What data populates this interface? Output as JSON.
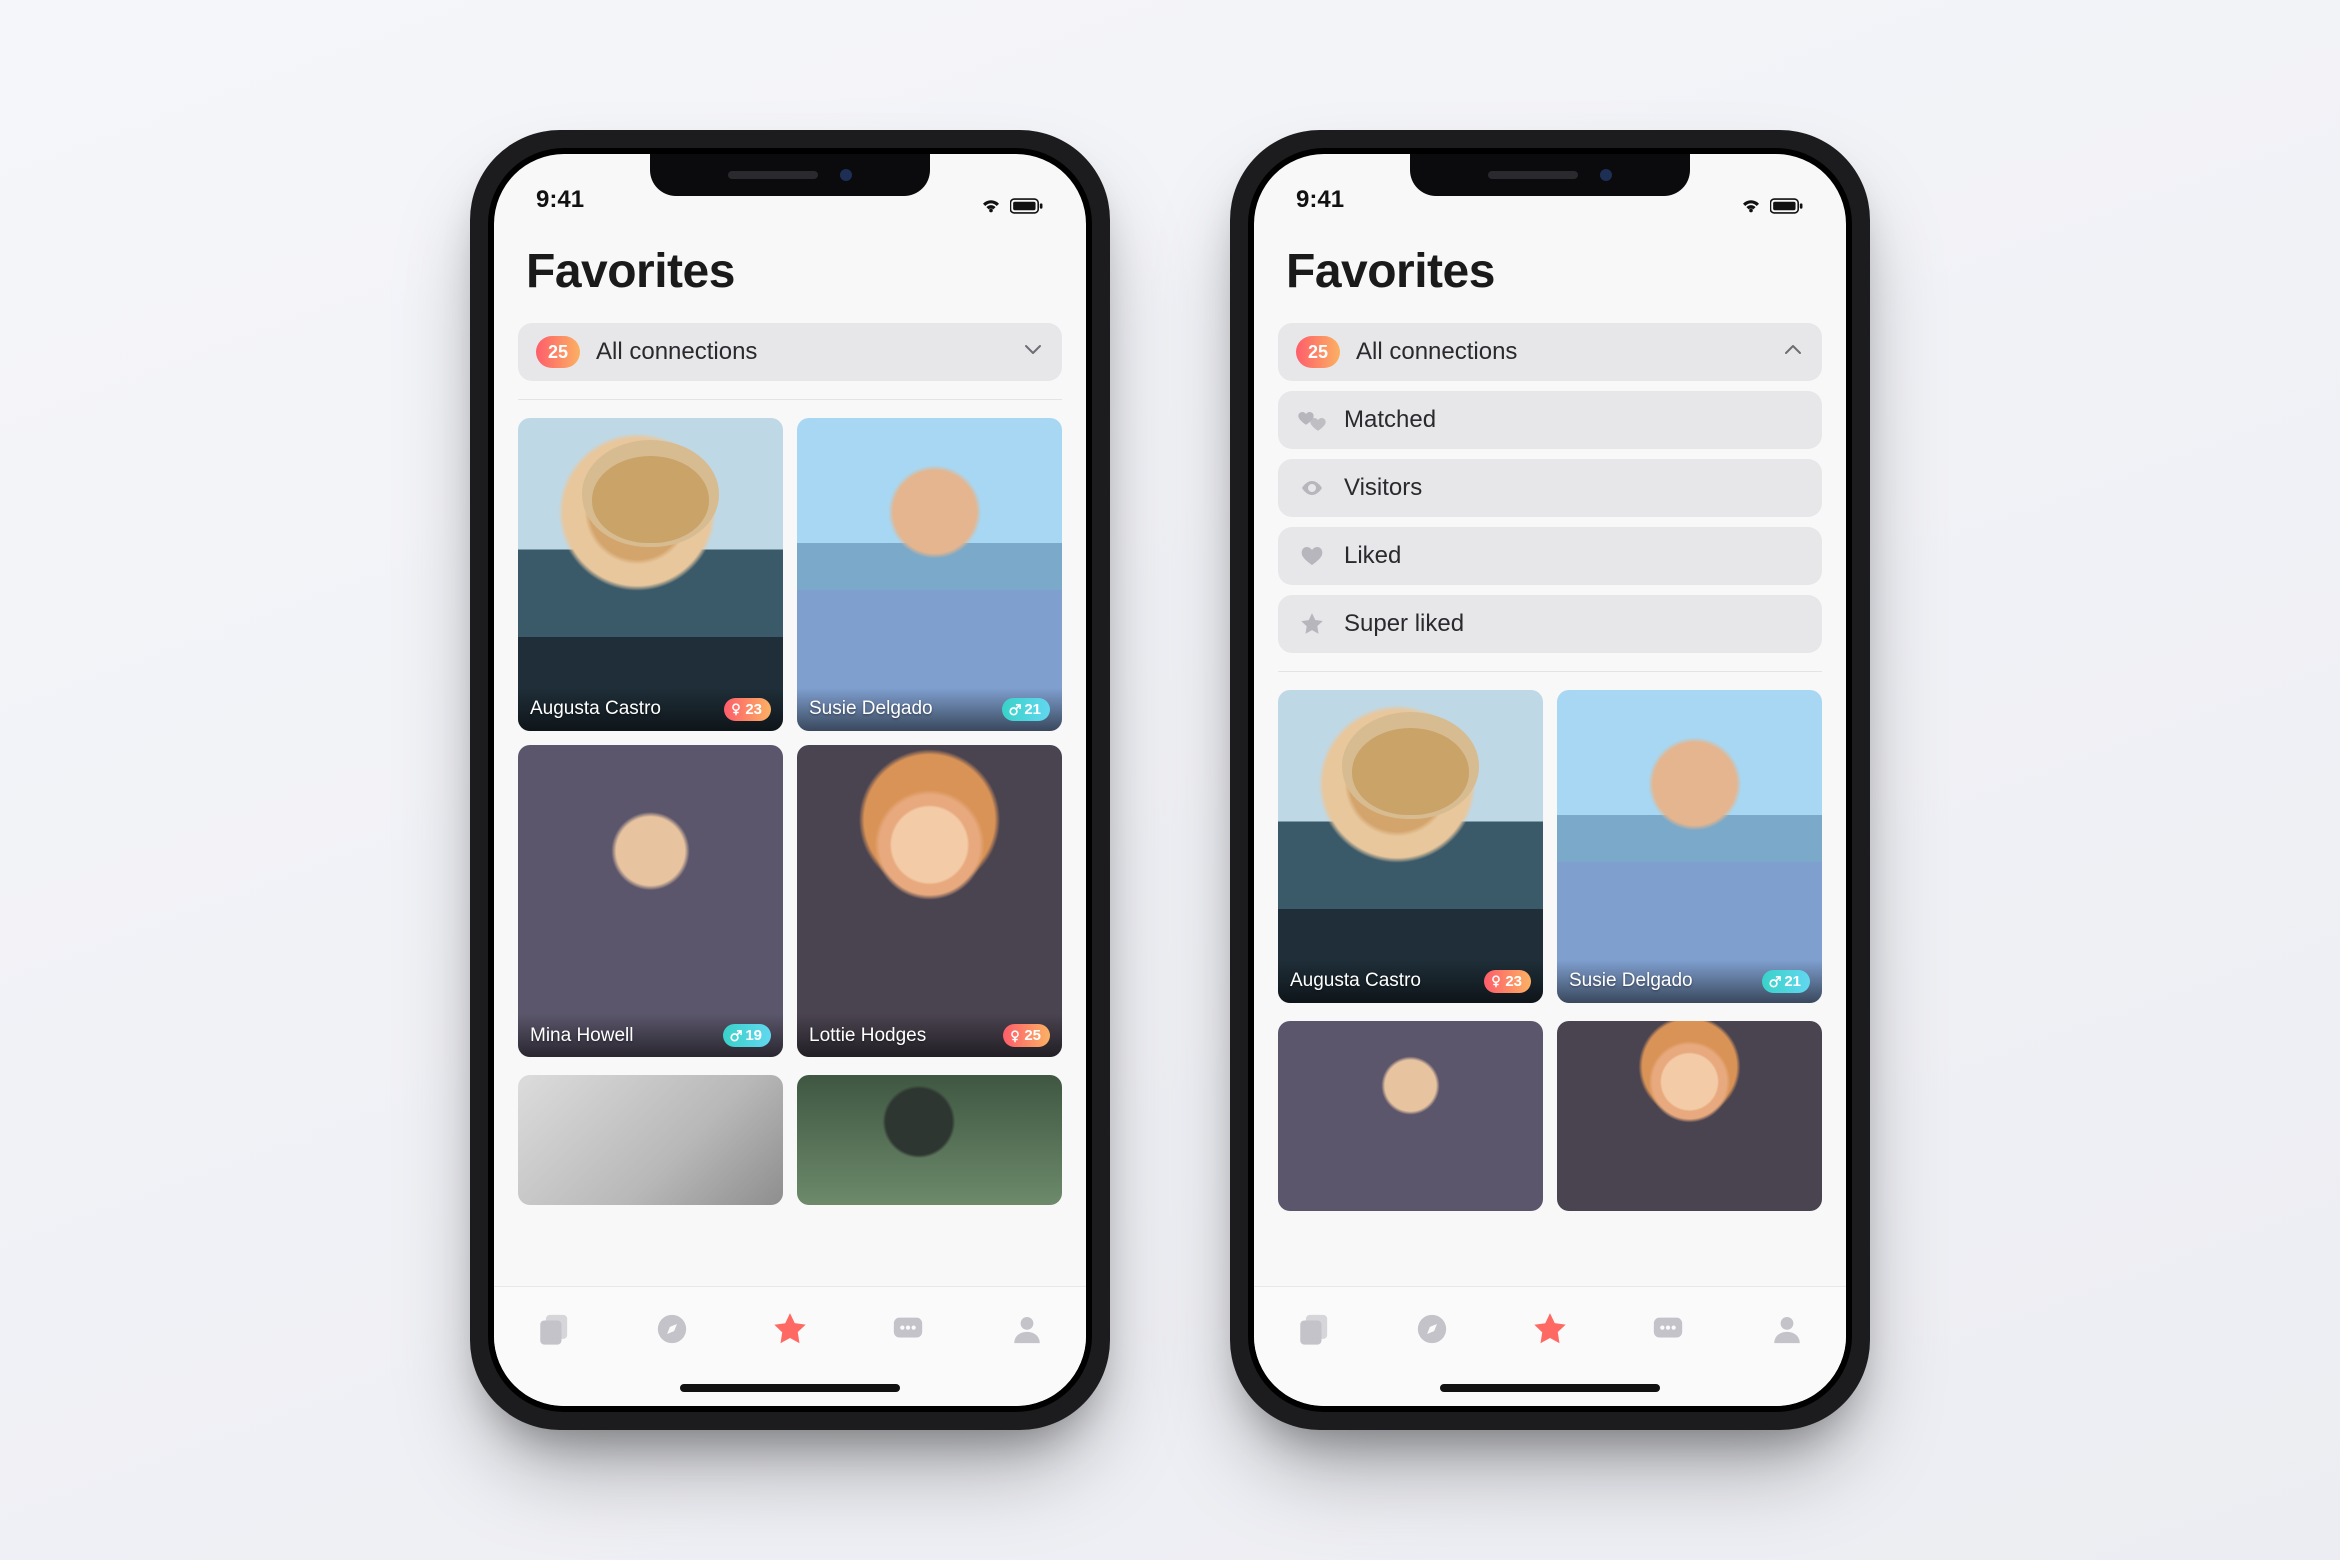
{
  "status": {
    "time": "9:41"
  },
  "page": {
    "title": "Favorites"
  },
  "filter": {
    "count": "25",
    "selected_label": "All connections",
    "options": [
      {
        "label": "Matched",
        "icon": "hearts-icon"
      },
      {
        "label": "Visitors",
        "icon": "eye-icon"
      },
      {
        "label": "Liked",
        "icon": "heart-icon"
      },
      {
        "label": "Super liked",
        "icon": "star-icon"
      }
    ]
  },
  "people": [
    {
      "name": "Augusta Castro",
      "age": "23",
      "gender": "female"
    },
    {
      "name": "Susie Delgado",
      "age": "21",
      "gender": "male"
    },
    {
      "name": "Mina Howell",
      "age": "19",
      "gender": "male"
    },
    {
      "name": "Lottie Hodges",
      "age": "25",
      "gender": "female"
    }
  ],
  "tabs": [
    {
      "name": "cards-tab",
      "icon": "stack-icon",
      "active": false
    },
    {
      "name": "explore-tab",
      "icon": "compass-icon",
      "active": false
    },
    {
      "name": "favorites-tab",
      "icon": "star-icon",
      "active": true
    },
    {
      "name": "chat-tab",
      "icon": "chat-icon",
      "active": false
    },
    {
      "name": "profile-tab",
      "icon": "person-icon",
      "active": false
    }
  ],
  "colors": {
    "accent_gradient_from": "#fe5d6a",
    "accent_gradient_to": "#fbb163",
    "accent_solid": "#fe6a63",
    "male_gradient_from": "#39d2c9",
    "male_gradient_to": "#62d7ef"
  }
}
